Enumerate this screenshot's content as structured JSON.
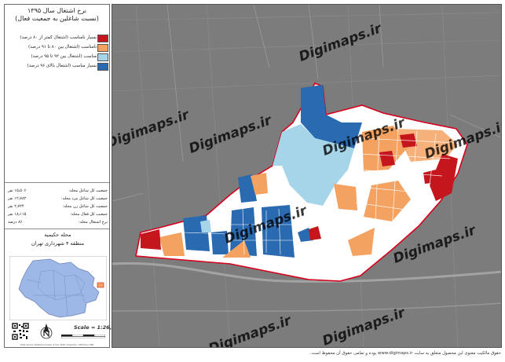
{
  "panel": {
    "title_line1": "نرخ اشتغال سال ۱۳۹۵",
    "title_line2": "(نسبت شاغلین به جمعیت فعال)"
  },
  "legend": [
    {
      "label": "بسیار نامناسب (اشتغال کمتر از ۸۰ درصد)",
      "color": "#c5161d"
    },
    {
      "label": "نامناسب (اشتغال بین ۸۰ تا ۹۱ درصد)",
      "color": "#f4a261"
    },
    {
      "label": "مناسب (اشتغال بین ۹۲ تا ۹۵ درصد)",
      "color": "#a6d4e8"
    },
    {
      "label": "بسیار مناسب (اشتغال بالای ۹۶ درصد)",
      "color": "#2a6ab0"
    }
  ],
  "stats": [
    {
      "label": "جمعیت کل شاغل محله:",
      "value": "۱۵٫۵۰۶ نفر"
    },
    {
      "label": "جمعیت کل شاغل مرد محله:",
      "value": "۱۲٫۷۸۲ نفر"
    },
    {
      "label": "جمعیت کل شاغل زن محله:",
      "value": "۲٫۷۲۴ نفر"
    },
    {
      "label": "جمعیت کل فعال محله:",
      "value": "۱۸٫۱۱۵ نفر"
    },
    {
      "label": "نرخ اشتغال محله:",
      "value": "۸۶ درصد"
    }
  ],
  "area": {
    "neighborhood": "محله حکیمیه",
    "district": "منطقه ۴ شهرداری تهران"
  },
  "scale": {
    "label": "Scale = 1:26,000",
    "credit": "Data Source: Statistical Center of Iran 2016 | Projection: UTM Zone 39N"
  },
  "map": {
    "watermarks": [
      "Digimaps.ir",
      "Digimaps.ir",
      "Digimaps.ir",
      "Digimaps.ir",
      "Digimaps.ir",
      "Digimaps.ir",
      "Digimaps.ir",
      "Digimaps.ir",
      "Digimaps.ir"
    ]
  },
  "footer": {
    "text": "حقوق مالکیت معنوی این محصول متعلق به سایت www.digimaps.ir بوده و تمامی حقوق آن محفوظ است."
  },
  "colors": {
    "very_poor": "#c5161d",
    "poor": "#f4a261",
    "good": "#a6d4e8",
    "very_good": "#2a6ab0",
    "boundary": "#d6001c",
    "basemap": "#7c7c7c",
    "district_fill": "#9db7e6"
  }
}
